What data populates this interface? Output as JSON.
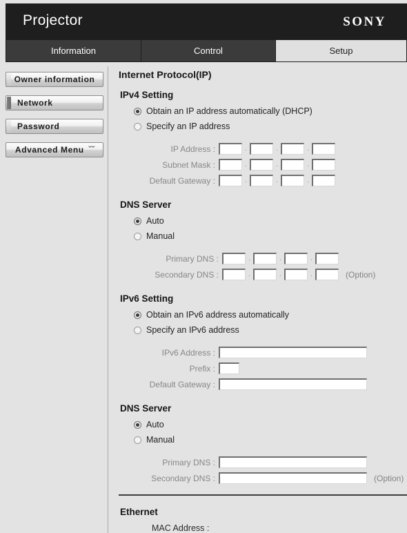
{
  "header": {
    "title": "Projector",
    "brand": "SONY"
  },
  "tabs": [
    {
      "label": "Information",
      "active": false
    },
    {
      "label": "Control",
      "active": false
    },
    {
      "label": "Setup",
      "active": true
    }
  ],
  "sidebar": {
    "items": [
      {
        "label": "Owner information",
        "active": false,
        "chevron": ""
      },
      {
        "label": "Network",
        "active": true,
        "chevron": ""
      },
      {
        "label": "Password",
        "active": false,
        "chevron": ""
      },
      {
        "label": "Advanced Menu",
        "active": false,
        "chevron": "ˇˇ"
      }
    ]
  },
  "main": {
    "page_heading": "Internet Protocol(IP)",
    "ipv4": {
      "heading": "IPv4 Setting",
      "radio_auto": "Obtain an IP address automatically (DHCP)",
      "radio_manual": "Specify an IP address",
      "selected": "auto",
      "fields": [
        {
          "label": "IP Address :",
          "octets": [
            "",
            "",
            "",
            ""
          ]
        },
        {
          "label": "Subnet Mask :",
          "octets": [
            "",
            "",
            "",
            ""
          ]
        },
        {
          "label": "Default Gateway :",
          "octets": [
            "",
            "",
            "",
            ""
          ]
        }
      ]
    },
    "dns4": {
      "heading": "DNS Server",
      "radio_auto": "Auto",
      "radio_manual": "Manual",
      "selected": "auto",
      "fields": [
        {
          "label": "Primary DNS :",
          "octets": [
            "",
            "",
            "",
            ""
          ],
          "suffix": ""
        },
        {
          "label": "Secondary DNS :",
          "octets": [
            "",
            "",
            "",
            ""
          ],
          "suffix": "(Option)"
        }
      ]
    },
    "ipv6": {
      "heading": "IPv6 Setting",
      "radio_auto": "Obtain an IPv6 address automatically",
      "radio_manual": "Specify an IPv6 address",
      "selected": "auto",
      "address_label": "IPv6 Address :",
      "address_value": "",
      "prefix_label": "Prefix :",
      "prefix_value": "",
      "gateway_label": "Default Gateway :",
      "gateway_value": ""
    },
    "dns6": {
      "heading": "DNS Server",
      "radio_auto": "Auto",
      "radio_manual": "Manual",
      "selected": "auto",
      "primary_label": "Primary DNS :",
      "primary_value": "",
      "secondary_label": "Secondary DNS :",
      "secondary_value": "",
      "secondary_suffix": "(Option)"
    },
    "ethernet": {
      "heading": "Ethernet",
      "mac_label": "MAC Address :",
      "mac_value": ""
    }
  },
  "colors": {
    "header_bg": "#1e1e1e",
    "tab_inactive_bg": "#3b3b3b",
    "tab_active_bg": "#e0e0e0",
    "page_bg": "#e3e3e3",
    "disabled_label": "#878787"
  }
}
